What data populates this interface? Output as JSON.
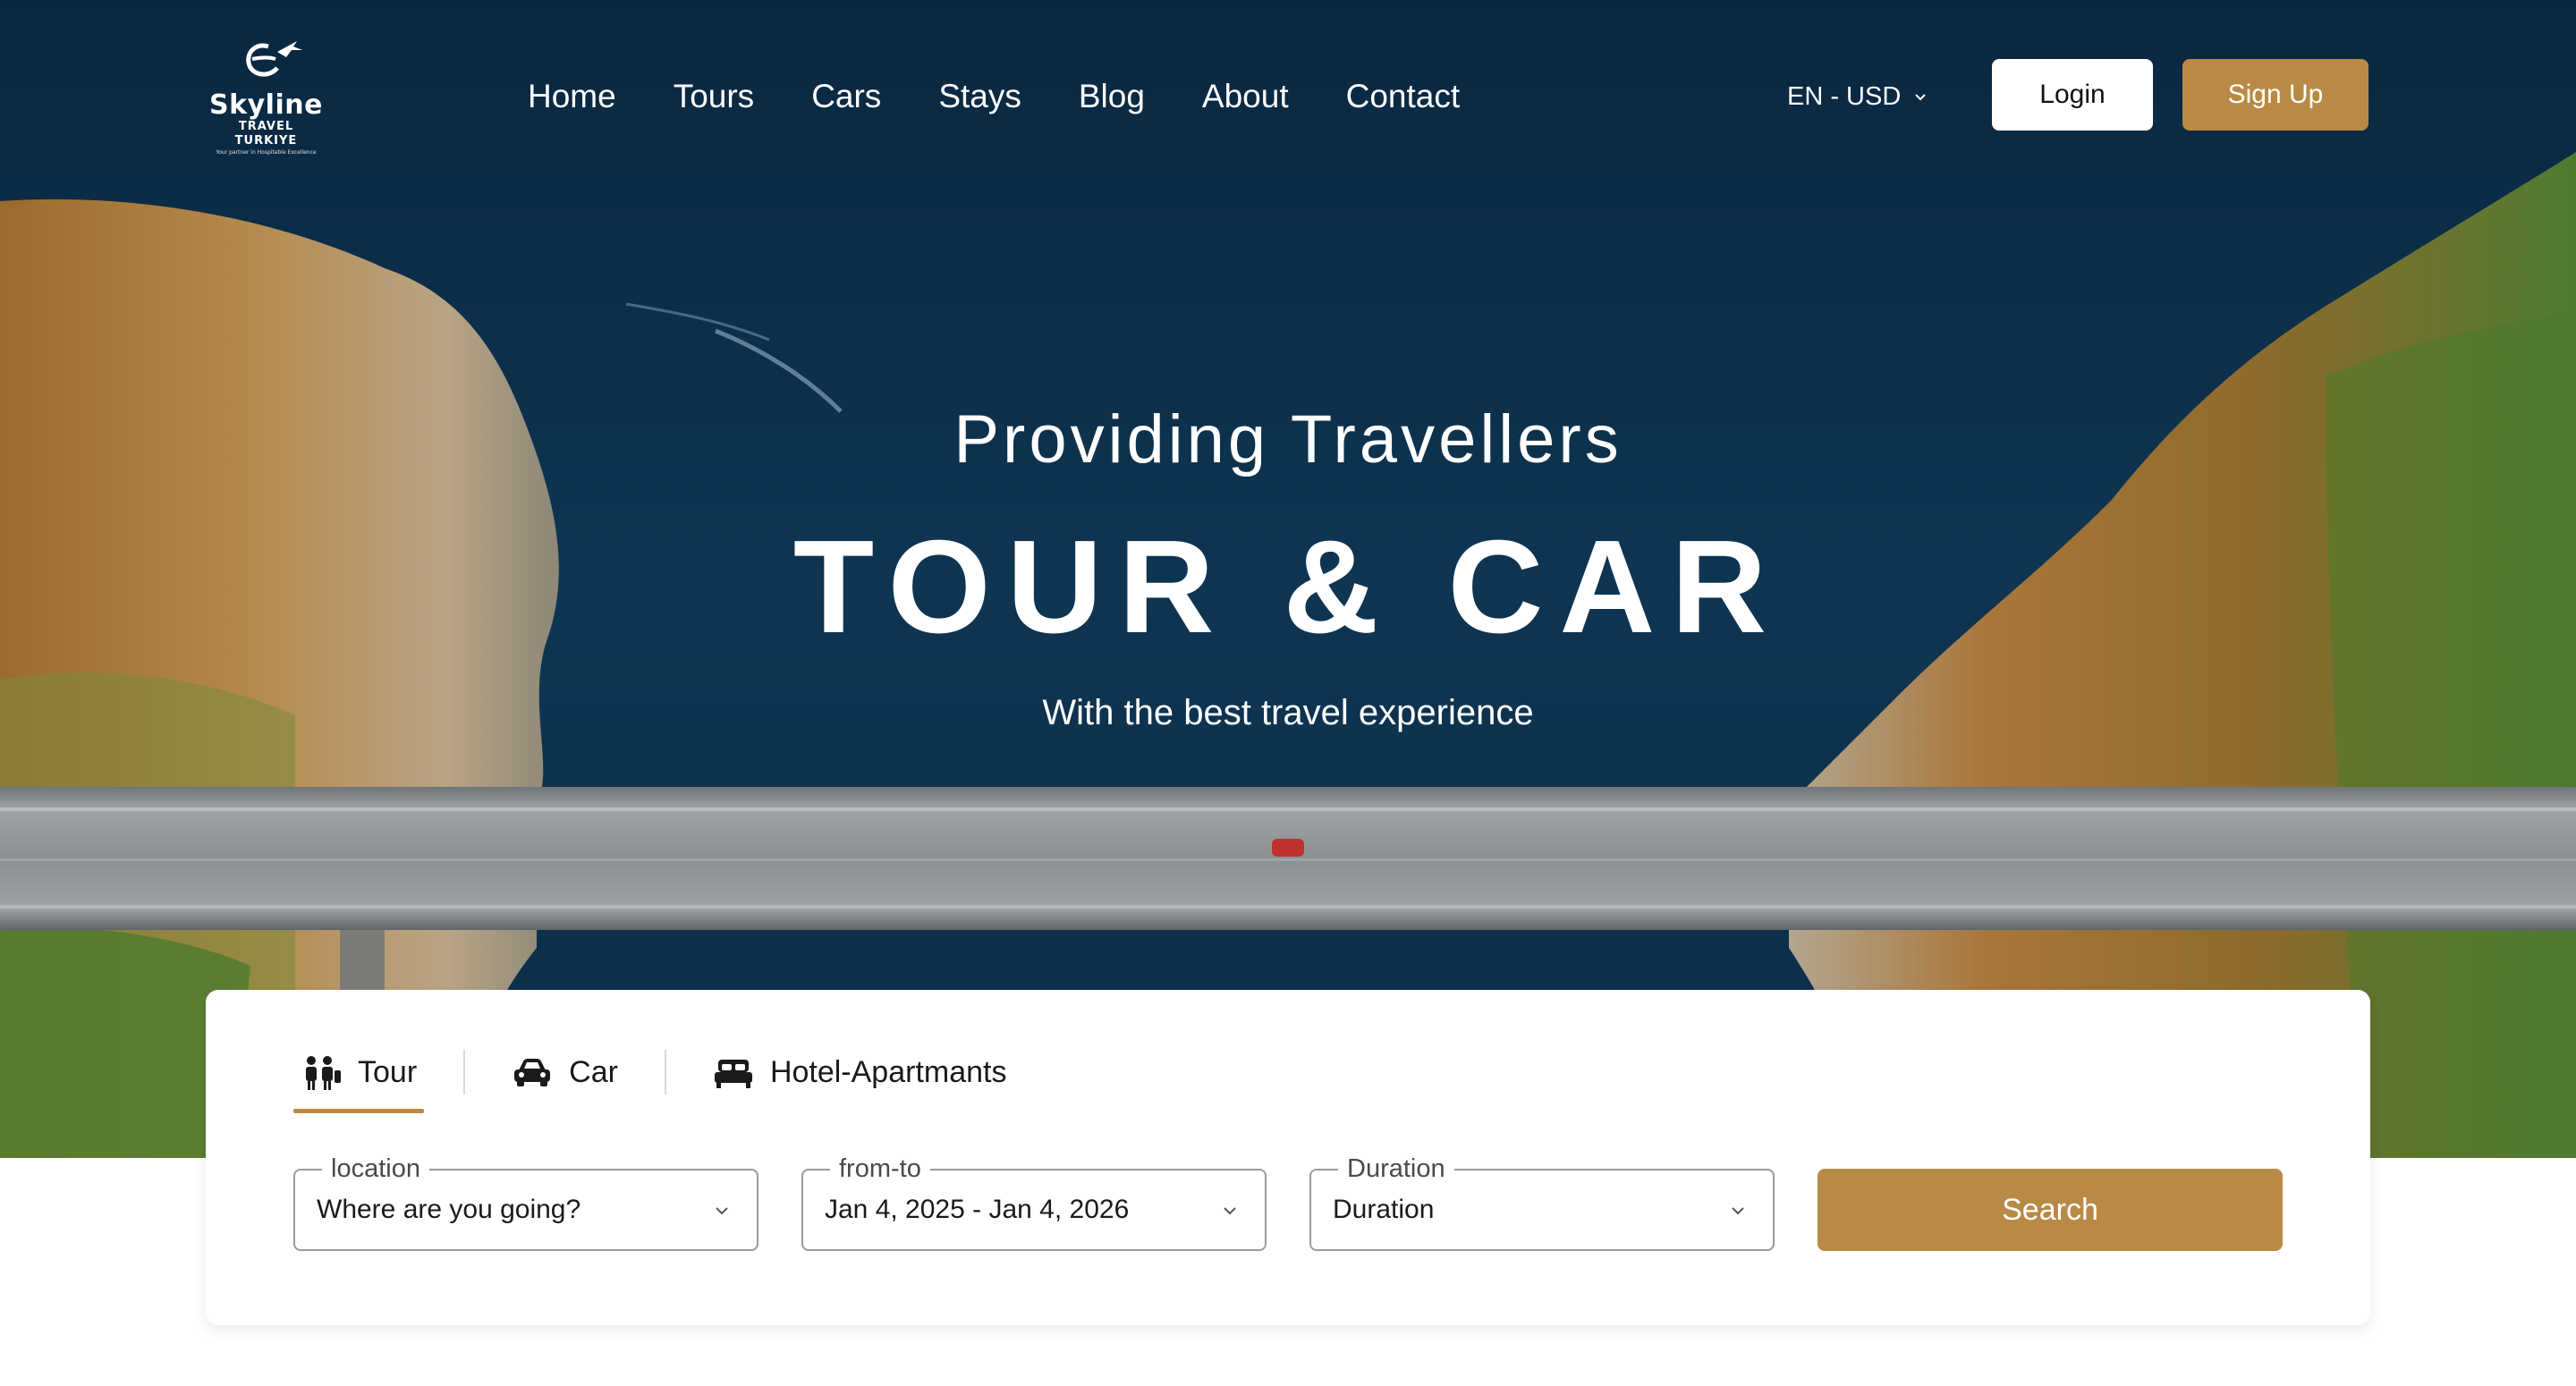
{
  "brand": {
    "name": "Skyline",
    "sub": "TRAVEL TURKIYE",
    "tagline": "Your partner in Hospitable Excellence"
  },
  "nav": {
    "items": [
      "Home",
      "Tours",
      "Cars",
      "Stays",
      "Blog",
      "About",
      "Contact"
    ]
  },
  "header": {
    "locale": "EN - USD",
    "login_label": "Login",
    "signup_label": "Sign Up"
  },
  "hero": {
    "kicker": "Providing Travellers",
    "title": "TOUR & CAR",
    "subtitle": "With the best travel experience"
  },
  "search": {
    "tabs": [
      {
        "label": "Tour",
        "icon": "family-icon",
        "active": true
      },
      {
        "label": "Car",
        "icon": "car-icon",
        "active": false
      },
      {
        "label": "Hotel-Apartmants",
        "icon": "bed-icon",
        "active": false
      }
    ],
    "location": {
      "legend": "location",
      "value": "Where are you going?"
    },
    "dates": {
      "legend": "from-to",
      "value": "Jan 4, 2025 - Jan 4, 2026"
    },
    "duration": {
      "legend": "Duration",
      "value": "Duration"
    },
    "search_label": "Search"
  },
  "colors": {
    "accent": "#b98a45",
    "water": "#0c2f4a",
    "white": "#ffffff"
  }
}
